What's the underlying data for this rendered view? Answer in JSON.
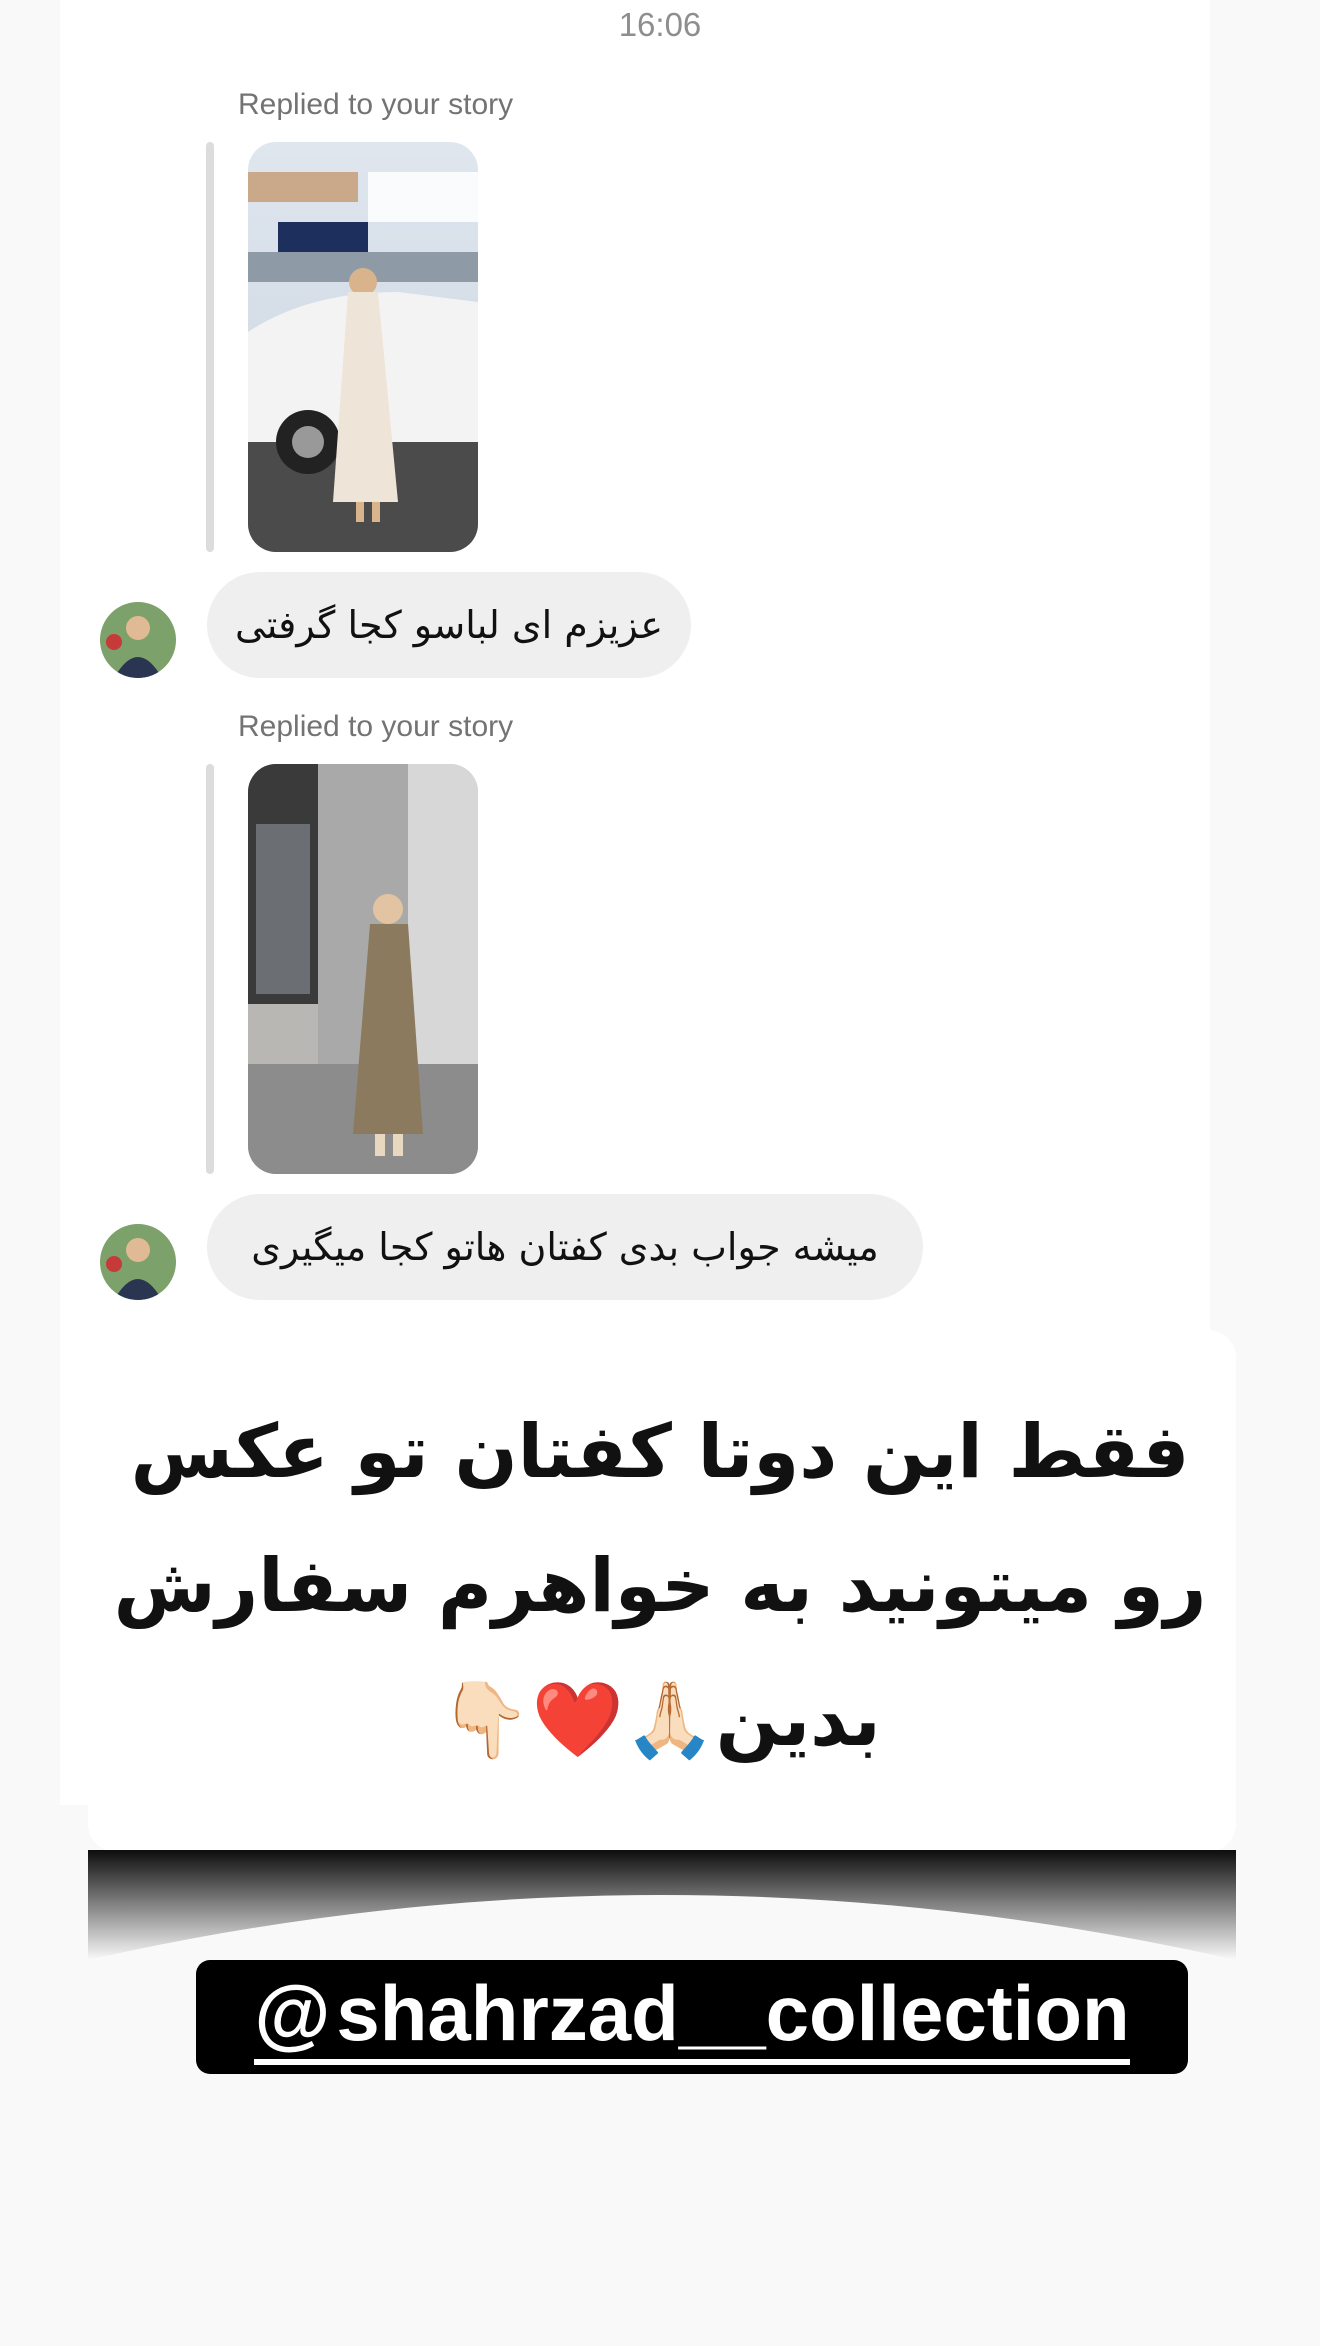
{
  "status": {
    "time": "16:06"
  },
  "messages": [
    {
      "replied_label": "Replied to your story",
      "story_image": "story-photo-white-dress-by-car",
      "text": "عزیزم ای لباسو کجا گرفتی"
    },
    {
      "replied_label": "Replied to your story",
      "story_image": "story-photo-beige-kaftan-in-mall",
      "text": "میشه جواب بدی کفتان هاتو کجا میگیری"
    }
  ],
  "overlay": {
    "line1": "فقط این دوتا کفتان تو عکس",
    "line2": "رو میتونید به خواهرم سفارش",
    "line3": "بدین🙏🏻❤️👇🏻"
  },
  "mention": {
    "icon": "threads-icon",
    "handle": "shahrzad__collection"
  },
  "colors": {
    "bubble": "#efefef",
    "label": "#737373",
    "time": "#8e8e8e",
    "mention_bg": "#000000"
  }
}
